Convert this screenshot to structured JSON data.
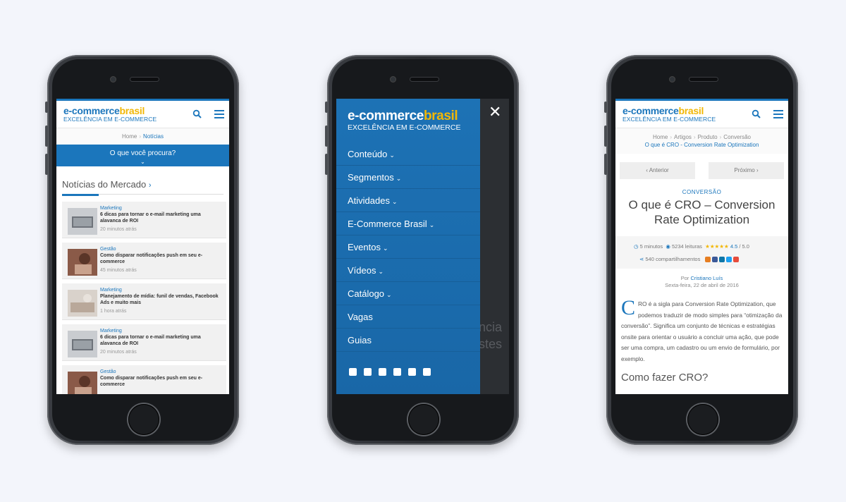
{
  "brand": {
    "name_part1": "e-commerce",
    "name_part2": "brasil",
    "tagline": "EXCELÊNCIA EM E-COMMERCE"
  },
  "phone1": {
    "breadcrumb": {
      "home": "Home",
      "current": "Notícias"
    },
    "search_label": "O que você procura?",
    "search_chevron": "⌄",
    "section_title": "Notícias do Mercado",
    "section_arrow": "›",
    "news": [
      {
        "category": "Marketing",
        "title": "6 dicas para tornar o e-mail marketing uma alavanca de ROI",
        "time": "20 minutos atrás"
      },
      {
        "category": "Gestão",
        "title": "Como disparar notificações push em seu e-commerce",
        "time": "45 minutos atrás"
      },
      {
        "category": "Marketing",
        "title": "Planejamento de mídia: funil de vendas, Facebook Ads e muito mais",
        "time": "1 hora atrás"
      },
      {
        "category": "Marketing",
        "title": "6 dicas para tornar o e-mail marketing uma alavanca de ROI",
        "time": "20 minutos atrás"
      },
      {
        "category": "Gestão",
        "title": "Como disparar notificações push em seu e-commerce",
        "time": ""
      }
    ]
  },
  "phone2": {
    "close_icon": "✕",
    "menu": [
      {
        "label": "Conteúdo",
        "chevron": "⌄"
      },
      {
        "label": "Segmentos",
        "chevron": "⌄"
      },
      {
        "label": "Atividades",
        "chevron": "⌄"
      },
      {
        "label": "E-Commerce Brasil",
        "chevron": "⌄"
      },
      {
        "label": "Eventos",
        "chevron": "⌄"
      },
      {
        "label": "Vídeos",
        "chevron": "⌄"
      },
      {
        "label": "Catálogo",
        "chevron": "⌄"
      },
      {
        "label": "Vagas",
        "chevron": ""
      },
      {
        "label": "Guias",
        "chevron": ""
      }
    ],
    "background_text": [
      "ncia",
      "stes"
    ]
  },
  "phone3": {
    "breadcrumb": [
      "Home",
      "Artigos",
      "Produto",
      "Conversão"
    ],
    "breadcrumb_current": "O que é CRO - Conversion Rate Optimization",
    "prev_label": "‹  Anterior",
    "next_label": "Próximo  ›",
    "kicker": "CONVERSÃO",
    "title": "O que é CRO – Conversion Rate Optimization",
    "read_time": "5 minutos",
    "reads": "5234 leituras",
    "stars": "★★★★★",
    "rating": "4.5",
    "rating_max": "/ 5.0",
    "shares": "540 compartilhamentos",
    "by": "Por",
    "author": "Cristiano Luís",
    "date": "Sexta-feira, 22 de abril de 2016",
    "dropcap": "C",
    "body": "RO é a sigla para Conversion Rate Optimization, que podemos traduzir de modo simples para “otimização da conversão”. Significa um conjunto de técnicas e estratégias onsite para orientar o usuário a concluir uma ação, que pode ser uma compra, um cadastro ou um envio de formulário, por exemplo.",
    "subheading": "Como fazer CRO?"
  },
  "colors": {
    "brand_blue": "#1b76bc",
    "brand_yellow": "#f2b705",
    "menu_blue": "#1b6eb0"
  }
}
